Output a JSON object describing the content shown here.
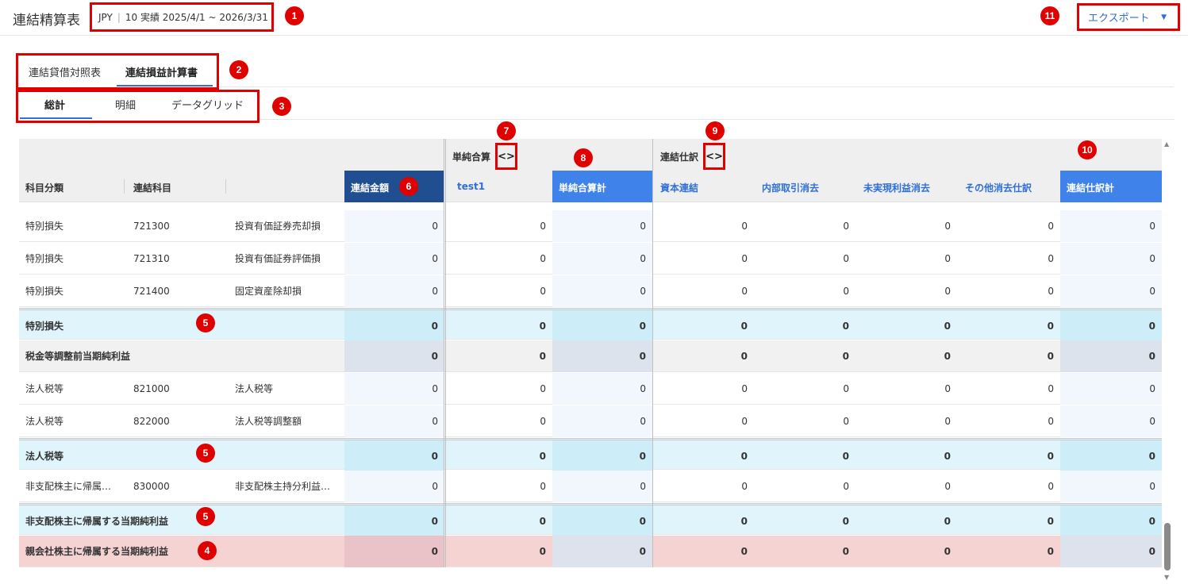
{
  "header": {
    "title": "連結精算表",
    "currency": "JPY",
    "period": "10 実績 2025/4/1 ~ 2026/3/31",
    "export_label": "エクスポート"
  },
  "tabs_primary": [
    {
      "label": "連結貸借対照表",
      "active": false
    },
    {
      "label": "連結損益計算書",
      "active": true
    }
  ],
  "tabs_secondary": [
    {
      "label": "総計",
      "active": true
    },
    {
      "label": "明細",
      "active": false
    },
    {
      "label": "データグリッド",
      "active": false
    }
  ],
  "grid": {
    "group_simple": "単純合算",
    "group_consol": "連結仕訳",
    "expand_glyph": "<>",
    "columns": {
      "category": "科目分類",
      "account": "連結科目",
      "amount": "連結金額",
      "test1": "test1",
      "simple_total": "単純合算計",
      "capital": "資本連結",
      "internal": "内部取引消去",
      "unrealized": "未実現利益消去",
      "other": "その他消去仕訳",
      "consol_total": "連結仕訳計"
    },
    "rows": [
      {
        "type": "normal",
        "category": "特別損失",
        "code": "721300",
        "name": "投資有価証券売却損",
        "values": [
          "0",
          "0",
          "0",
          "0",
          "0",
          "0",
          "0",
          "0"
        ]
      },
      {
        "type": "normal",
        "category": "特別損失",
        "code": "721310",
        "name": "投資有価証券評価損",
        "values": [
          "0",
          "0",
          "0",
          "0",
          "0",
          "0",
          "0",
          "0"
        ]
      },
      {
        "type": "normal",
        "category": "特別損失",
        "code": "721400",
        "name": "固定資産除却損",
        "values": [
          "0",
          "0",
          "0",
          "0",
          "0",
          "0",
          "0",
          "0"
        ]
      },
      {
        "type": "sub",
        "category": "特別損失",
        "code": "",
        "name": "",
        "values": [
          "0",
          "0",
          "0",
          "0",
          "0",
          "0",
          "0",
          "0"
        ]
      },
      {
        "type": "tot",
        "category": "税金等調整前当期純利益",
        "code": "",
        "name": "",
        "values": [
          "0",
          "0",
          "0",
          "0",
          "0",
          "0",
          "0",
          "0"
        ]
      },
      {
        "type": "normal",
        "category": "法人税等",
        "code": "821000",
        "name": "法人税等",
        "values": [
          "0",
          "0",
          "0",
          "0",
          "0",
          "0",
          "0",
          "0"
        ]
      },
      {
        "type": "normal",
        "category": "法人税等",
        "code": "822000",
        "name": "法人税等調整額",
        "values": [
          "0",
          "0",
          "0",
          "0",
          "0",
          "0",
          "0",
          "0"
        ]
      },
      {
        "type": "sub",
        "category": "法人税等",
        "code": "",
        "name": "",
        "values": [
          "0",
          "0",
          "0",
          "0",
          "0",
          "0",
          "0",
          "0"
        ]
      },
      {
        "type": "normal",
        "category": "非支配株主に帰属…",
        "code": "830000",
        "name": "非支配株主持分利益…",
        "values": [
          "0",
          "0",
          "0",
          "0",
          "0",
          "0",
          "0",
          "0"
        ]
      },
      {
        "type": "sub",
        "category": "非支配株主に帰属する当期純利益",
        "code": "",
        "name": "",
        "values": [
          "0",
          "0",
          "0",
          "0",
          "0",
          "0",
          "0",
          "0"
        ]
      },
      {
        "type": "par",
        "category": "親会社株主に帰属する当期純利益",
        "code": "",
        "name": "",
        "values": [
          "0",
          "0",
          "0",
          "0",
          "0",
          "0",
          "0",
          "0"
        ]
      }
    ]
  },
  "markers": [
    "1",
    "2",
    "3",
    "4",
    "5",
    "6",
    "7",
    "8",
    "9",
    "10",
    "11"
  ],
  "colors": {
    "accent": "#2f6fd6",
    "highlight": "#e00000",
    "col_blue": "#3f82ea",
    "col_dark": "#1f4f91"
  }
}
